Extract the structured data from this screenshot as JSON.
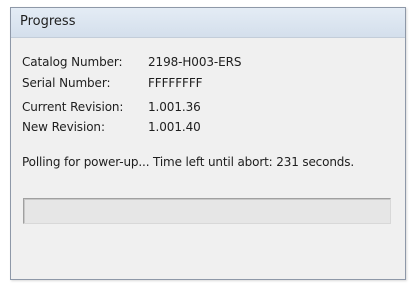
{
  "window": {
    "title": "Progress"
  },
  "info": {
    "catalog_number": {
      "label": "Catalog Number:",
      "value": "2198-H003-ERS"
    },
    "serial_number": {
      "label": "Serial Number:",
      "value": "FFFFFFFF"
    },
    "current_revision": {
      "label": "Current Revision:",
      "value": "1.001.36"
    },
    "new_revision": {
      "label": "New Revision:",
      "value": "1.001.40"
    }
  },
  "status": {
    "message": "Polling for power-up... Time left until abort: 231 seconds."
  },
  "progress": {
    "fraction": 0.0
  }
}
